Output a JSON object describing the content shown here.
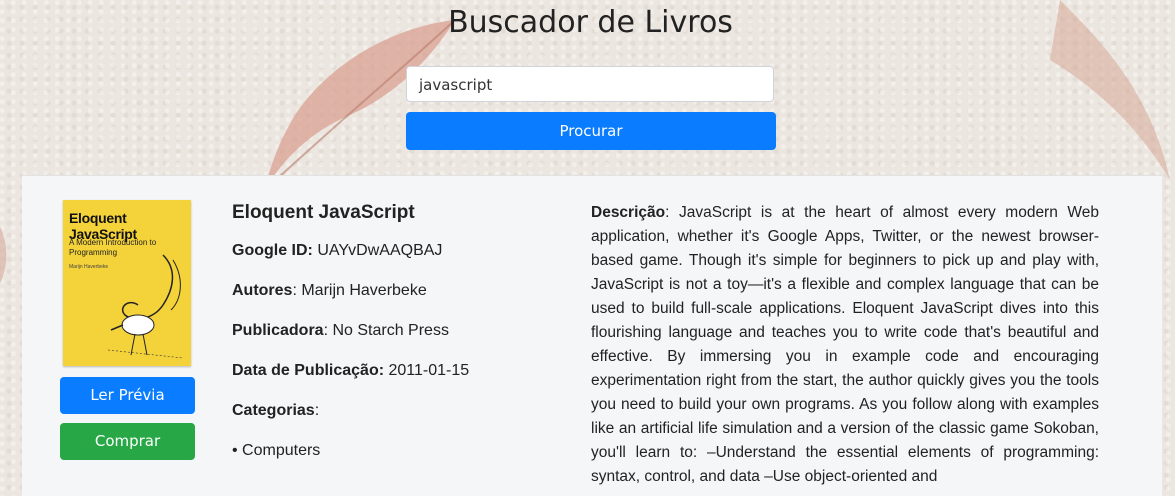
{
  "header": {
    "title": "Buscador de Livros"
  },
  "search": {
    "value": "javascript",
    "button_label": "Procurar"
  },
  "book": {
    "cover": {
      "title": "Eloquent JavaScript",
      "subtitle": "A Modern Introduction to Programming",
      "author": "Marijn Haverbeke"
    },
    "preview_label": "Ler Prévia",
    "buy_label": "Comprar",
    "title": "Eloquent JavaScript",
    "google_id_label": "Google ID:",
    "google_id": "UAYvDwAAQBAJ",
    "authors_label": "Autores",
    "authors": "Marijn Haverbeke",
    "publisher_label": "Publicadora",
    "publisher": "No Starch Press",
    "published_label": "Data de Publicação:",
    "published": "2011-01-15",
    "categories_label": "Categorias",
    "categories": [
      "Computers"
    ],
    "description_label": "Descrição",
    "description": "JavaScript is at the heart of almost every modern Web application, whether it's Google Apps, Twitter, or the newest browser-based game. Though it's simple for beginners to pick up and play with, JavaScript is not a toy—it's a flexible and complex language that can be used to build full-scale applications. Eloquent JavaScript dives into this flourishing language and teaches you to write code that's beautiful and effective. By immersing you in example code and encouraging experimentation right from the start, the author quickly gives you the tools you need to build your own programs. As you follow along with examples like an artificial life simulation and a version of the classic game Sokoban, you'll learn to: –Understand the essential elements of programming: syntax, control, and data –Use object-oriented and"
  },
  "colors": {
    "primary": "#0a7cff",
    "success": "#27a745",
    "card_bg": "#f4f6f8"
  }
}
